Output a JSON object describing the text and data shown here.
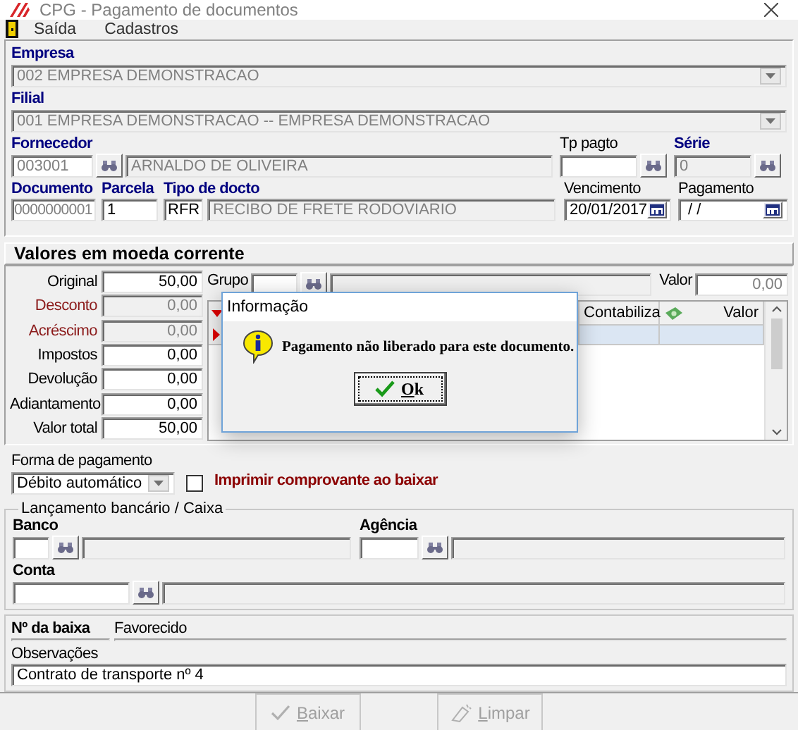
{
  "window": {
    "title": "CPG - Pagamento de documentos"
  },
  "menu": [
    {
      "label": "Saída"
    },
    {
      "label": "Cadastros"
    }
  ],
  "empresa": {
    "label": "Empresa",
    "required": true,
    "value": "002 EMPRESA DEMONSTRACAO"
  },
  "filial": {
    "label": "Filial",
    "required": true,
    "value": "001 EMPRESA DEMONSTRACAO -- EMPRESA DEMONSTRACAO"
  },
  "fornecedor": {
    "label": "Fornecedor",
    "required": true,
    "code": "003001",
    "name": "ARNALDO DE OLIVEIRA"
  },
  "tp_pagto": {
    "label": "Tp pagto",
    "required": false
  },
  "serie": {
    "label": "Série",
    "required": true,
    "value": "0"
  },
  "documento": {
    "label": "Documento",
    "required": true,
    "value": "0000000001"
  },
  "parcela": {
    "label": "Parcela",
    "required": true,
    "value": "1"
  },
  "tipo_docto": {
    "label": "Tipo de docto",
    "required": true,
    "code": "RFR",
    "name": "RECIBO DE FRETE RODOVIARIO"
  },
  "vencimento": {
    "label": "Vencimento",
    "required": false,
    "value": "20/01/2017"
  },
  "pagamento": {
    "label": "Pagamento",
    "required": false,
    "value": " / /"
  },
  "valores": {
    "title": "Valores em moeda corrente",
    "rows": [
      {
        "label": "Original",
        "value": "50,00",
        "disabled": false
      },
      {
        "label": "Desconto",
        "value": "0,00",
        "disabled": true
      },
      {
        "label": "Acréscimo",
        "value": "0,00",
        "disabled": true
      },
      {
        "label": "Impostos",
        "value": "0,00",
        "disabled": false
      },
      {
        "label": "Devolução",
        "value": "0,00",
        "disabled": false
      },
      {
        "label": "Adiantamento",
        "value": "0,00",
        "disabled": false
      },
      {
        "label": "Valor total",
        "value": "50,00",
        "disabled": false
      }
    ]
  },
  "grupo": {
    "label": "Grupo"
  },
  "valor": {
    "label": "Valor",
    "value": "0,00"
  },
  "grid": {
    "columns": [
      {
        "label": "Contabiliza",
        "kind": "text"
      },
      {
        "label": "Valor",
        "kind": "money"
      }
    ],
    "rows": [
      {
        "selected": true
      }
    ]
  },
  "dialog": {
    "title": "Informação",
    "message": "Pagamento não liberado para este documento.",
    "button": "Ok"
  },
  "forma_pagamento": {
    "label": "Forma de pagamento",
    "value": "Débito automático"
  },
  "imprimir": {
    "label": "Imprimir comprovante ao baixar",
    "checked": false
  },
  "lancamento": {
    "title": "Lançamento bancário / Caixa",
    "banco": "Banco",
    "agencia": "Agência",
    "conta": "Conta"
  },
  "baixa": {
    "label": "Nº da baixa"
  },
  "favorecido": {
    "label": "Favorecido"
  },
  "observacoes": {
    "label": "Observações",
    "value": "Contrato de transporte nº 4"
  },
  "buttons": [
    {
      "label": "Baixar",
      "kind": "confirm",
      "disabled": true
    },
    {
      "label": "Limpar",
      "kind": "clear",
      "disabled": true
    }
  ]
}
